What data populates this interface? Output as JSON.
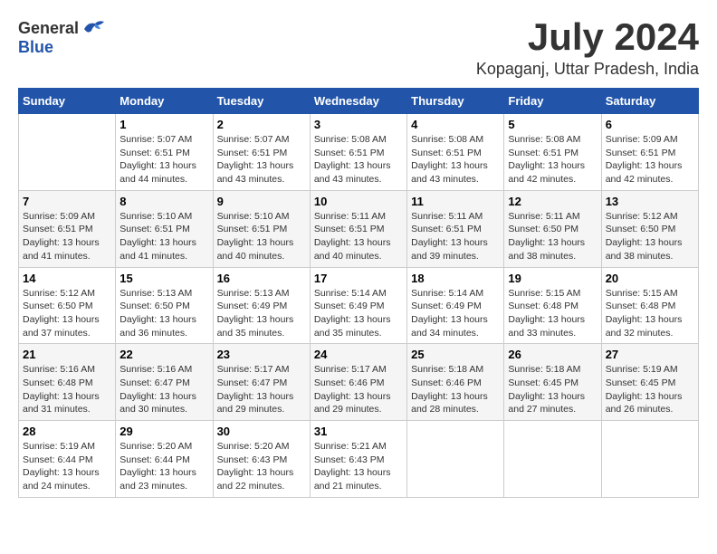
{
  "logo": {
    "general": "General",
    "blue": "Blue"
  },
  "title": {
    "month_year": "July 2024",
    "location": "Kopaganj, Uttar Pradesh, India"
  },
  "calendar": {
    "headers": [
      "Sunday",
      "Monday",
      "Tuesday",
      "Wednesday",
      "Thursday",
      "Friday",
      "Saturday"
    ],
    "weeks": [
      [
        {
          "day": "",
          "sunrise": "",
          "sunset": "",
          "daylight": ""
        },
        {
          "day": "1",
          "sunrise": "Sunrise: 5:07 AM",
          "sunset": "Sunset: 6:51 PM",
          "daylight": "Daylight: 13 hours and 44 minutes."
        },
        {
          "day": "2",
          "sunrise": "Sunrise: 5:07 AM",
          "sunset": "Sunset: 6:51 PM",
          "daylight": "Daylight: 13 hours and 43 minutes."
        },
        {
          "day": "3",
          "sunrise": "Sunrise: 5:08 AM",
          "sunset": "Sunset: 6:51 PM",
          "daylight": "Daylight: 13 hours and 43 minutes."
        },
        {
          "day": "4",
          "sunrise": "Sunrise: 5:08 AM",
          "sunset": "Sunset: 6:51 PM",
          "daylight": "Daylight: 13 hours and 43 minutes."
        },
        {
          "day": "5",
          "sunrise": "Sunrise: 5:08 AM",
          "sunset": "Sunset: 6:51 PM",
          "daylight": "Daylight: 13 hours and 42 minutes."
        },
        {
          "day": "6",
          "sunrise": "Sunrise: 5:09 AM",
          "sunset": "Sunset: 6:51 PM",
          "daylight": "Daylight: 13 hours and 42 minutes."
        }
      ],
      [
        {
          "day": "7",
          "sunrise": "Sunrise: 5:09 AM",
          "sunset": "Sunset: 6:51 PM",
          "daylight": "Daylight: 13 hours and 41 minutes."
        },
        {
          "day": "8",
          "sunrise": "Sunrise: 5:10 AM",
          "sunset": "Sunset: 6:51 PM",
          "daylight": "Daylight: 13 hours and 41 minutes."
        },
        {
          "day": "9",
          "sunrise": "Sunrise: 5:10 AM",
          "sunset": "Sunset: 6:51 PM",
          "daylight": "Daylight: 13 hours and 40 minutes."
        },
        {
          "day": "10",
          "sunrise": "Sunrise: 5:11 AM",
          "sunset": "Sunset: 6:51 PM",
          "daylight": "Daylight: 13 hours and 40 minutes."
        },
        {
          "day": "11",
          "sunrise": "Sunrise: 5:11 AM",
          "sunset": "Sunset: 6:51 PM",
          "daylight": "Daylight: 13 hours and 39 minutes."
        },
        {
          "day": "12",
          "sunrise": "Sunrise: 5:11 AM",
          "sunset": "Sunset: 6:50 PM",
          "daylight": "Daylight: 13 hours and 38 minutes."
        },
        {
          "day": "13",
          "sunrise": "Sunrise: 5:12 AM",
          "sunset": "Sunset: 6:50 PM",
          "daylight": "Daylight: 13 hours and 38 minutes."
        }
      ],
      [
        {
          "day": "14",
          "sunrise": "Sunrise: 5:12 AM",
          "sunset": "Sunset: 6:50 PM",
          "daylight": "Daylight: 13 hours and 37 minutes."
        },
        {
          "day": "15",
          "sunrise": "Sunrise: 5:13 AM",
          "sunset": "Sunset: 6:50 PM",
          "daylight": "Daylight: 13 hours and 36 minutes."
        },
        {
          "day": "16",
          "sunrise": "Sunrise: 5:13 AM",
          "sunset": "Sunset: 6:49 PM",
          "daylight": "Daylight: 13 hours and 35 minutes."
        },
        {
          "day": "17",
          "sunrise": "Sunrise: 5:14 AM",
          "sunset": "Sunset: 6:49 PM",
          "daylight": "Daylight: 13 hours and 35 minutes."
        },
        {
          "day": "18",
          "sunrise": "Sunrise: 5:14 AM",
          "sunset": "Sunset: 6:49 PM",
          "daylight": "Daylight: 13 hours and 34 minutes."
        },
        {
          "day": "19",
          "sunrise": "Sunrise: 5:15 AM",
          "sunset": "Sunset: 6:48 PM",
          "daylight": "Daylight: 13 hours and 33 minutes."
        },
        {
          "day": "20",
          "sunrise": "Sunrise: 5:15 AM",
          "sunset": "Sunset: 6:48 PM",
          "daylight": "Daylight: 13 hours and 32 minutes."
        }
      ],
      [
        {
          "day": "21",
          "sunrise": "Sunrise: 5:16 AM",
          "sunset": "Sunset: 6:48 PM",
          "daylight": "Daylight: 13 hours and 31 minutes."
        },
        {
          "day": "22",
          "sunrise": "Sunrise: 5:16 AM",
          "sunset": "Sunset: 6:47 PM",
          "daylight": "Daylight: 13 hours and 30 minutes."
        },
        {
          "day": "23",
          "sunrise": "Sunrise: 5:17 AM",
          "sunset": "Sunset: 6:47 PM",
          "daylight": "Daylight: 13 hours and 29 minutes."
        },
        {
          "day": "24",
          "sunrise": "Sunrise: 5:17 AM",
          "sunset": "Sunset: 6:46 PM",
          "daylight": "Daylight: 13 hours and 29 minutes."
        },
        {
          "day": "25",
          "sunrise": "Sunrise: 5:18 AM",
          "sunset": "Sunset: 6:46 PM",
          "daylight": "Daylight: 13 hours and 28 minutes."
        },
        {
          "day": "26",
          "sunrise": "Sunrise: 5:18 AM",
          "sunset": "Sunset: 6:45 PM",
          "daylight": "Daylight: 13 hours and 27 minutes."
        },
        {
          "day": "27",
          "sunrise": "Sunrise: 5:19 AM",
          "sunset": "Sunset: 6:45 PM",
          "daylight": "Daylight: 13 hours and 26 minutes."
        }
      ],
      [
        {
          "day": "28",
          "sunrise": "Sunrise: 5:19 AM",
          "sunset": "Sunset: 6:44 PM",
          "daylight": "Daylight: 13 hours and 24 minutes."
        },
        {
          "day": "29",
          "sunrise": "Sunrise: 5:20 AM",
          "sunset": "Sunset: 6:44 PM",
          "daylight": "Daylight: 13 hours and 23 minutes."
        },
        {
          "day": "30",
          "sunrise": "Sunrise: 5:20 AM",
          "sunset": "Sunset: 6:43 PM",
          "daylight": "Daylight: 13 hours and 22 minutes."
        },
        {
          "day": "31",
          "sunrise": "Sunrise: 5:21 AM",
          "sunset": "Sunset: 6:43 PM",
          "daylight": "Daylight: 13 hours and 21 minutes."
        },
        {
          "day": "",
          "sunrise": "",
          "sunset": "",
          "daylight": ""
        },
        {
          "day": "",
          "sunrise": "",
          "sunset": "",
          "daylight": ""
        },
        {
          "day": "",
          "sunrise": "",
          "sunset": "",
          "daylight": ""
        }
      ]
    ]
  }
}
